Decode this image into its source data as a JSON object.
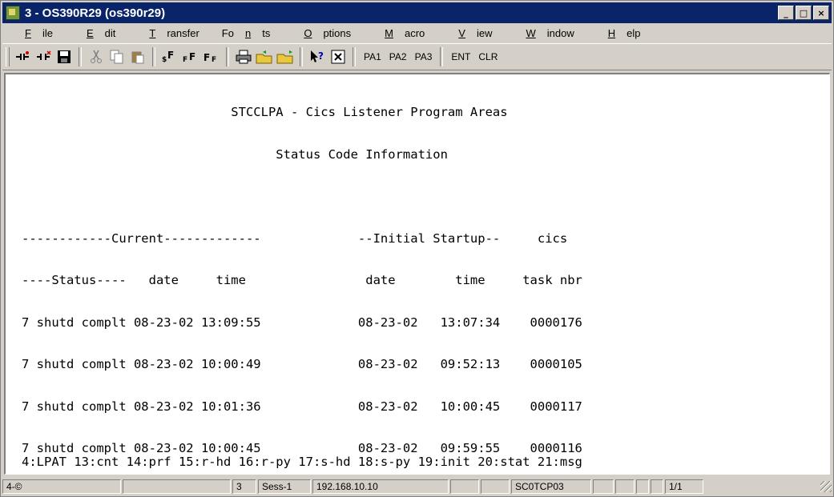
{
  "window": {
    "title": "3 - OS390R29 (os390r29)",
    "controls": {
      "minimize": "_",
      "maximize": "□",
      "close": "×"
    }
  },
  "menu": [
    {
      "pre": "",
      "u": "F",
      "post": "ile"
    },
    {
      "pre": "",
      "u": "E",
      "post": "dit"
    },
    {
      "pre": "",
      "u": "T",
      "post": "ransfer"
    },
    {
      "pre": "Fo",
      "u": "n",
      "post": "ts"
    },
    {
      "pre": "",
      "u": "O",
      "post": "ptions"
    },
    {
      "pre": "",
      "u": "M",
      "post": "acro"
    },
    {
      "pre": "",
      "u": "V",
      "post": "iew"
    },
    {
      "pre": "",
      "u": "W",
      "post": "indow"
    },
    {
      "pre": "",
      "u": "H",
      "post": "elp"
    }
  ],
  "toolbar": {
    "pa1": "PA1",
    "pa2": "PA2",
    "pa3": "PA3",
    "ent": "ENT",
    "clr": "CLR"
  },
  "terminal": {
    "lines": [
      "                            STCCLPA - Cics Listener Program Areas",
      "                                  Status Code Information",
      "",
      "------------Current-------------             --Initial Startup--     cics",
      "----Status----   date     time                date        time     task nbr",
      "7 shutd complt 08-23-02 13:09:55             08-23-02   13:07:34    0000176",
      "7 shutd complt 08-23-02 10:00:49             08-23-02   09:52:13    0000105",
      "7 shutd complt 08-23-02 10:01:36             08-23-02   10:00:45    0000117",
      "7 shutd complt 08-23-02 10:00:45             08-23-02   09:59:55    0000116"
    ],
    "pfkeys": "4:LPAT 13:cnt 14:prf 15:r-hd 16:r-py 17:s-hd 18:s-py 19:init 20:stat 21:msg"
  },
  "status": {
    "f1": "4-©",
    "f2": "",
    "f3": "3",
    "f4": "Sess-1",
    "f5": "192.168.10.10",
    "f6": "",
    "f7": "",
    "f8": "SC0TCP03",
    "f9": "",
    "f10": "",
    "f11": "",
    "f12": "",
    "f13": "1/1"
  }
}
